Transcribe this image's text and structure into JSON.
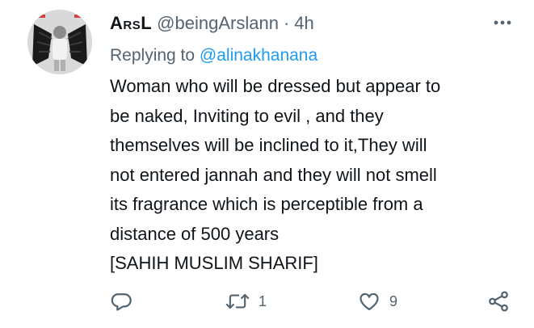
{
  "tweet": {
    "display_name": "ArsL",
    "handle": "@beingArslann",
    "separator": "·",
    "time": "4h",
    "replying_prefix": "Replying to",
    "replying_to": "@alinakhanana",
    "body_lines": [
      "Woman who will be dressed but appear to",
      "be naked, Inviting to evil , and they",
      "themselves will be inclined to it,They will",
      "not entered jannah and they will not smell",
      "its fragrance which is perceptible from a",
      "distance of 500 years",
      "[SAHIH MUSLIM SHARIF]"
    ]
  },
  "actions": {
    "reply_icon": "reply-bubble-icon",
    "retweet_icon": "retweet-icon",
    "retweet_count": "1",
    "like_icon": "heart-icon",
    "like_count": "9",
    "share_icon": "share-icon"
  },
  "colors": {
    "text": "#0f1419",
    "secondary": "#536471",
    "link": "#1d9bf0",
    "icon": "#536471"
  }
}
